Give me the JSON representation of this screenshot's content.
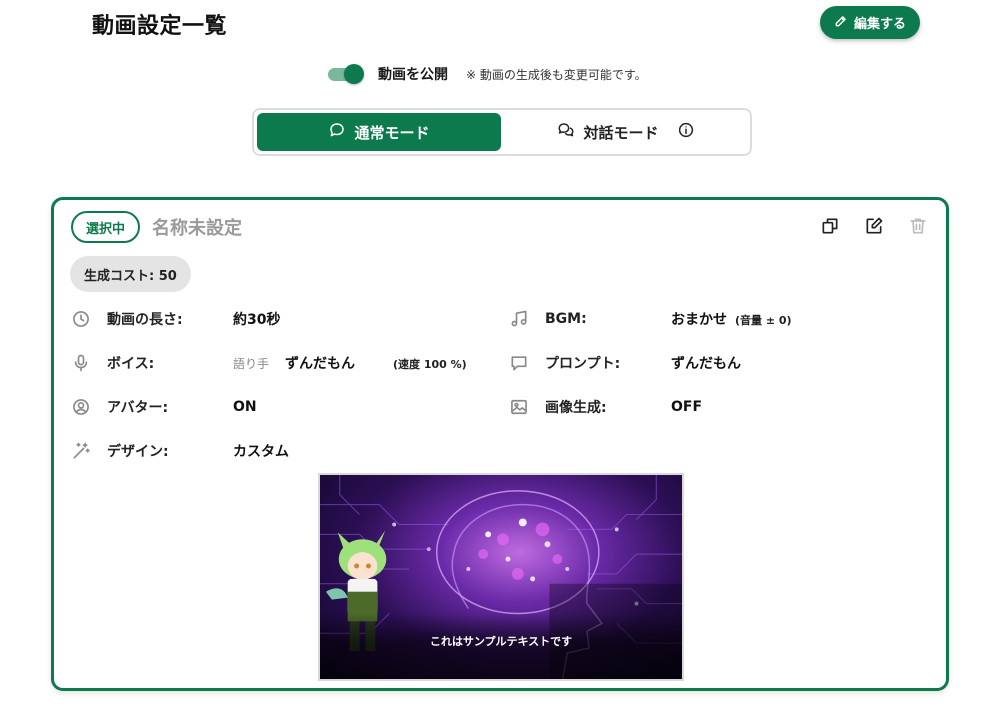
{
  "header": {
    "title": "動画設定一覧",
    "edit_label": "編集する"
  },
  "publish": {
    "label": "動画を公開",
    "note": "※ 動画の生成後も変更可能です。",
    "enabled": true
  },
  "modes": {
    "normal": "通常モード",
    "dialogue": "対話モード",
    "active": "normal"
  },
  "card": {
    "badge": "選択中",
    "name": "名称未設定",
    "cost_label": "生成コスト: 50",
    "rows": {
      "length": {
        "label": "動画の長さ:",
        "value": "約30秒"
      },
      "bgm": {
        "label": "BGM:",
        "value": "おまかせ",
        "extra": "(音量 ± 0)"
      },
      "voice": {
        "label": "ボイス:",
        "prefix": "語り手",
        "value": "ずんだもん",
        "extra": "(速度 100 %)"
      },
      "prompt": {
        "label": "プロンプト:",
        "value": "ずんだもん"
      },
      "avatar": {
        "label": "アバター:",
        "value": "ON"
      },
      "image_gen": {
        "label": "画像生成:",
        "value": "OFF"
      },
      "design": {
        "label": "デザイン:",
        "value": "カスタム"
      }
    },
    "preview_caption": "これはサンプルテキストです"
  },
  "colors": {
    "accent": "#0d7a4e",
    "toggle_track": "#79b89b",
    "chip_bg": "#e4e4e4"
  },
  "icons": {
    "length": "clock-icon",
    "bgm": "music-note-icon",
    "voice": "microphone-icon",
    "prompt": "speech-bubble-icon",
    "avatar": "user-circle-icon",
    "image_gen": "image-icon",
    "design": "magic-wand-icon"
  }
}
